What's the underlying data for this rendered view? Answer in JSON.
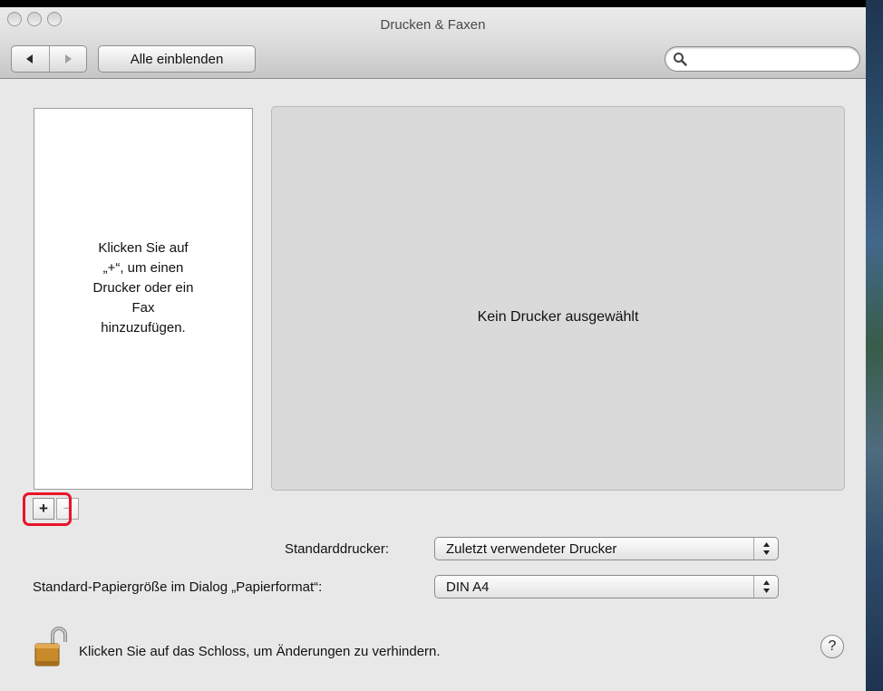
{
  "window": {
    "title": "Drucken & Faxen"
  },
  "toolbar": {
    "back_icon": "triangle-left",
    "forward_icon": "triangle-right",
    "show_all_label": "Alle einblenden",
    "search": {
      "value": "",
      "placeholder": "",
      "icon": "magnifier"
    }
  },
  "printer_list": {
    "hint_lines": [
      "Klicken Sie auf",
      "„+“, um einen",
      "Drucker oder ein",
      "Fax",
      "hinzuzufügen."
    ]
  },
  "detail": {
    "message": "Kein Drucker ausgewählt"
  },
  "list_controls": {
    "add_label": "+",
    "remove_label": "−",
    "highlight_color": "#e8142a"
  },
  "settings": {
    "default_printer_label": "Standarddrucker:",
    "default_printer_value": "Zuletzt verwendeter Drucker",
    "paper_size_label": "Standard-Papiergröße im Dialog „Papierformat“:",
    "paper_size_value": "DIN A4"
  },
  "footer": {
    "lock_icon": "padlock-open",
    "lock_text": "Klicken Sie auf das Schloss, um Änderungen zu verhindern.",
    "help_label": "?"
  }
}
